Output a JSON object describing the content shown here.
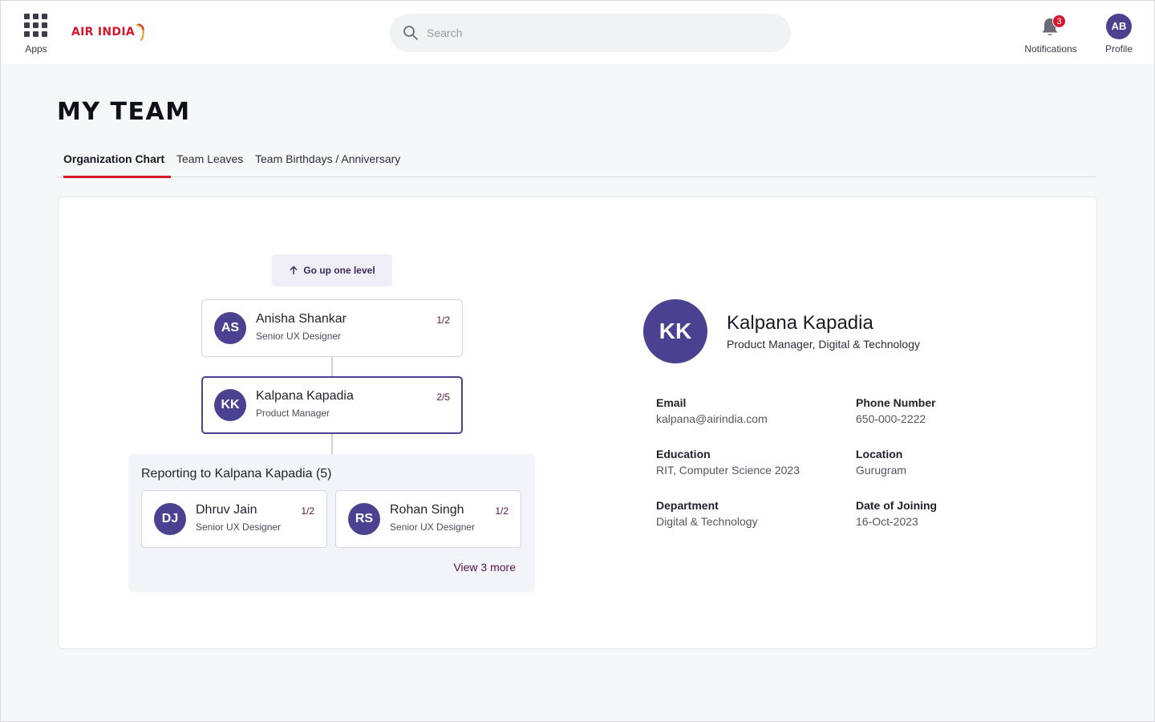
{
  "header": {
    "apps_label": "Apps",
    "logo_text": "AIR INDIA",
    "search_placeholder": "Search",
    "notifications_label": "Notifications",
    "notifications_count": "3",
    "profile_initials": "AB",
    "profile_label": "Profile"
  },
  "page": {
    "title": "MY TEAM",
    "tabs": [
      {
        "label": "Organization Chart",
        "active": true
      },
      {
        "label": "Team Leaves",
        "active": false
      },
      {
        "label": "Team Birthdays / Anniversary",
        "active": false
      }
    ]
  },
  "org_chart": {
    "go_up_label": "Go up one level",
    "manager": {
      "initials": "AS",
      "name": "Anisha Shankar",
      "role": "Senior UX Designer",
      "count": "1/2"
    },
    "selected": {
      "initials": "KK",
      "name": "Kalpana Kapadia",
      "role": "Product Manager",
      "count": "2/5"
    },
    "reports_title": "Reporting to Kalpana Kapadia (5)",
    "reports": [
      {
        "initials": "DJ",
        "name": "Dhruv Jain",
        "role": "Senior UX Designer",
        "count": "1/2"
      },
      {
        "initials": "RS",
        "name": "Rohan Singh",
        "role": "Senior UX Designer",
        "count": "1/2"
      }
    ],
    "view_more_label": "View 3 more"
  },
  "detail": {
    "initials": "KK",
    "name": "Kalpana Kapadia",
    "role": "Product Manager, Digital & Technology",
    "fields": {
      "email": {
        "label": "Email",
        "value": "kalpana@airindia.com"
      },
      "phone": {
        "label": "Phone Number",
        "value": "650-000-2222"
      },
      "education": {
        "label": "Education",
        "value": "RIT, Computer Science 2023"
      },
      "location": {
        "label": "Location",
        "value": "Gurugram"
      },
      "department": {
        "label": "Department",
        "value": "Digital & Technology"
      },
      "joining": {
        "label": "Date of Joining",
        "value": "16-Oct-2023"
      }
    }
  },
  "colors": {
    "brand_red": "#d4182c",
    "avatar_purple": "#4b4191",
    "accent_plum": "#5a1446"
  }
}
